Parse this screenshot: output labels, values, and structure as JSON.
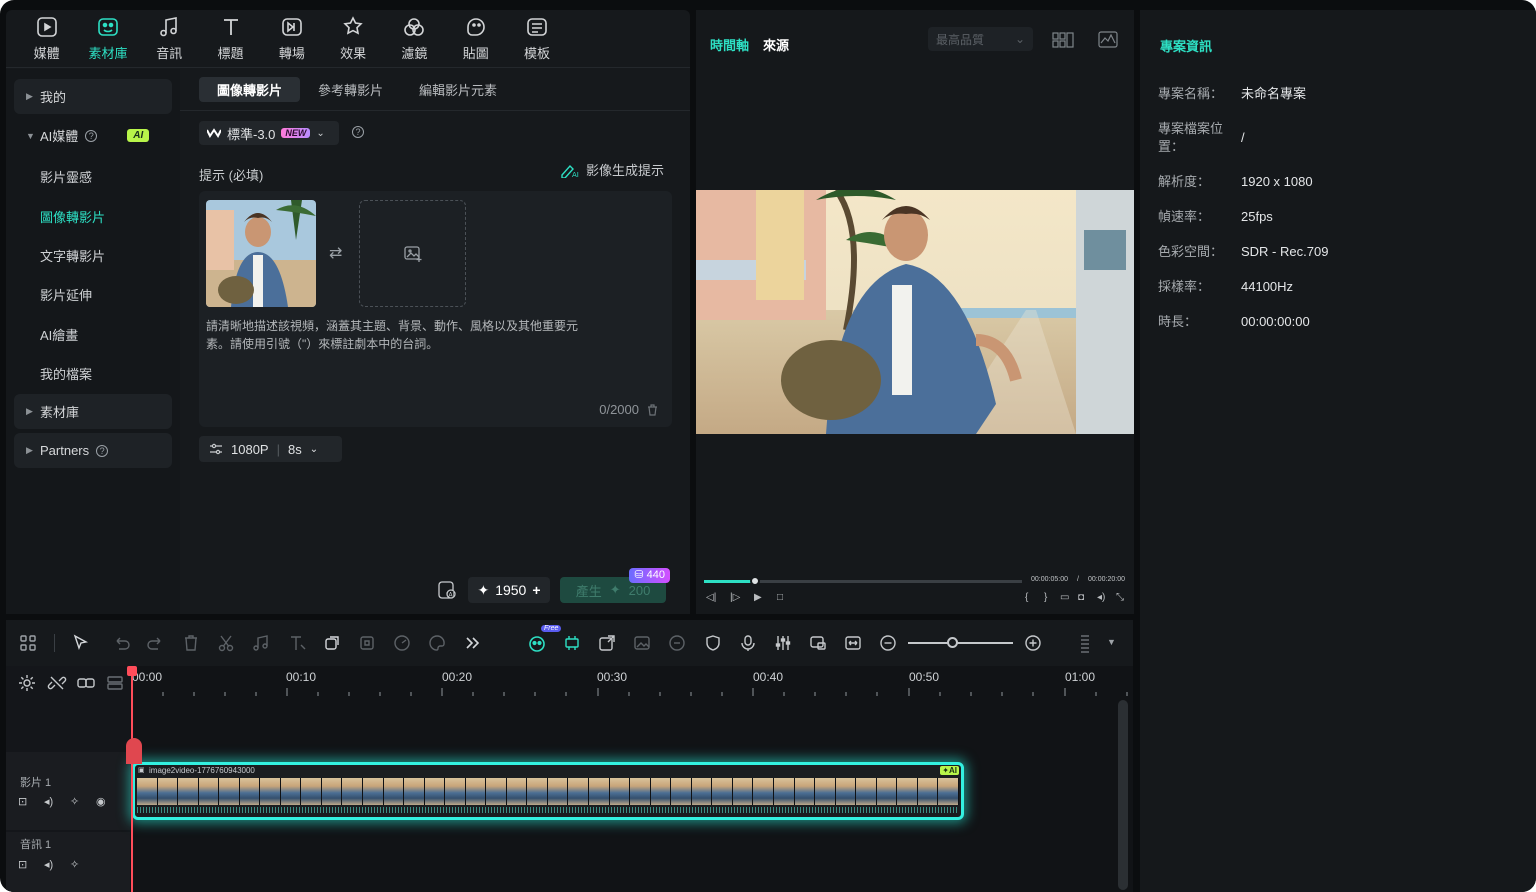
{
  "library_tabs": [
    {
      "label": "媒體",
      "icon": "media-icon",
      "active": false
    },
    {
      "label": "素材庫",
      "icon": "stock-library-icon",
      "active": true
    },
    {
      "label": "音訊",
      "icon": "audio-icon",
      "active": false
    },
    {
      "label": "標題",
      "icon": "title-icon",
      "active": false
    },
    {
      "label": "轉場",
      "icon": "transition-icon",
      "active": false
    },
    {
      "label": "效果",
      "icon": "effects-icon",
      "active": false
    },
    {
      "label": "濾鏡",
      "icon": "filters-icon",
      "active": false
    },
    {
      "label": "貼圖",
      "icon": "stickers-icon",
      "active": false
    },
    {
      "label": "模板",
      "icon": "templates-icon",
      "active": false
    }
  ],
  "sidebar": {
    "mine": "我的",
    "ai_media": "AI媒體",
    "ai_badge": "AI",
    "sub_items": [
      "影片靈感",
      "圖像轉影片",
      "文字轉影片",
      "影片延伸",
      "AI繪畫",
      "我的檔案"
    ],
    "active_sub": "圖像轉影片",
    "stock": "素材庫",
    "partners": "Partners"
  },
  "content": {
    "tabs": [
      "圖像轉影片",
      "參考轉影片",
      "編輯影片元素"
    ],
    "active_tab": "圖像轉影片",
    "model": "標準-3.0",
    "new_badge": "NEW",
    "prompt_label": "提示 (必填)",
    "gen_prompt_label": "影像生成提示",
    "hint": "請清晰地描述該視頻，涵蓋其主題、背景、動作、風格以及其他重要元素。請使用引號（\"）來標註劇本中的台詞。",
    "counter": "0/2000",
    "resolution": "1080P",
    "duration": "8s",
    "credits": "1950",
    "generate_label": "產生",
    "generate_cost": "200",
    "cost_badge": "440"
  },
  "player": {
    "tab_timeline": "時間軸",
    "tab_source": "來源",
    "quality": "最高品質",
    "current_time": "00:00:05:00",
    "separator": "/",
    "total_time": "00:00:20:00",
    "progress": 0.16
  },
  "project_info": {
    "title": "專案資訊",
    "rows": [
      {
        "key": "專案名稱：",
        "value": "未命名專案"
      },
      {
        "key": "專案檔案位置：",
        "value": "/"
      },
      {
        "key": "解析度：",
        "value": "1920 x 1080"
      },
      {
        "key": "幀速率：",
        "value": "25fps"
      },
      {
        "key": "色彩空間：",
        "value": "SDR - Rec.709"
      },
      {
        "key": "採樣率：",
        "value": "44100Hz"
      },
      {
        "key": "時長：",
        "value": "00:00:00:00"
      }
    ]
  },
  "timeline": {
    "ruler": [
      "00:00",
      "00:10",
      "00:20",
      "00:30",
      "00:40",
      "00:50",
      "01:00"
    ],
    "free_badge": "Free",
    "clip_name": "image2video-1776760943000",
    "clip_ai": "✦AI",
    "video_track": "影片 1",
    "audio_track": "音訊 1"
  },
  "colors": {
    "accent": "#2de0c4",
    "clip_glow": "#33f0e0",
    "ai_badge": "#b8f54a"
  }
}
